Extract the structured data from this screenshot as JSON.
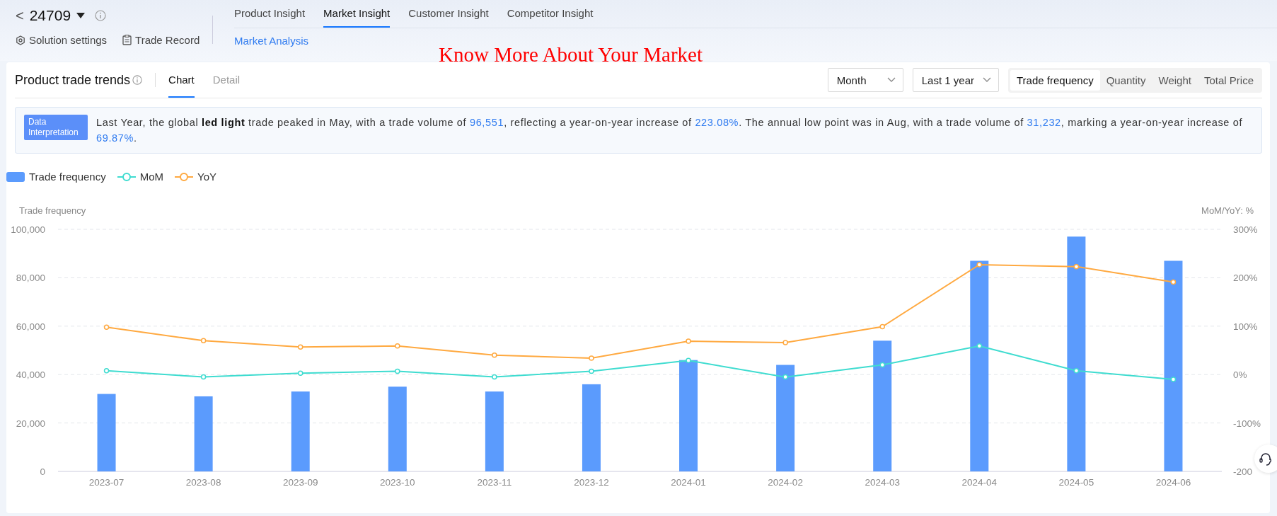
{
  "header": {
    "back": "<",
    "title": "24709",
    "links": [
      {
        "kind": "settings",
        "label": "Solution settings"
      },
      {
        "kind": "record",
        "label": "Trade Record"
      }
    ],
    "tabs": [
      {
        "label": "Product Insight",
        "selected": false
      },
      {
        "label": "Market Insight",
        "selected": true
      },
      {
        "label": "Customer Insight",
        "selected": false
      },
      {
        "label": "Competitor Insight",
        "selected": false
      }
    ],
    "subtabs": [
      {
        "label": "Market Analysis",
        "selected": true
      }
    ]
  },
  "annotation": "Know More About Your Market",
  "panel": {
    "title": "Product trade trends",
    "tabs": [
      {
        "label": "Chart",
        "selected": true
      },
      {
        "label": "Detail",
        "selected": false
      }
    ],
    "selects": [
      {
        "value": "Month"
      },
      {
        "value": "Last 1 year"
      }
    ],
    "metrics": [
      {
        "label": "Trade frequency",
        "selected": true
      },
      {
        "label": "Quantity",
        "selected": false
      },
      {
        "label": "Weight",
        "selected": false
      },
      {
        "label": "Total Price",
        "selected": false
      }
    ],
    "interpretation": {
      "label": "Data Interpretation",
      "segments": [
        {
          "kind": "plain",
          "text": "Last Year, the global "
        },
        {
          "kind": "bold",
          "text": "led light"
        },
        {
          "kind": "plain",
          "text": " trade peaked in May, with a trade volume of "
        },
        {
          "kind": "number",
          "text": "96,551"
        },
        {
          "kind": "plain",
          "text": ", reflecting a year-on-year increase of "
        },
        {
          "kind": "number",
          "text": "223.08%"
        },
        {
          "kind": "plain",
          "text": ". The annual low point was in Aug, with a trade volume of "
        },
        {
          "kind": "number",
          "text": "31,232"
        },
        {
          "kind": "plain",
          "text": ", marking a year-on-year increase of "
        },
        {
          "kind": "number",
          "text": "69.87%"
        },
        {
          "kind": "plain",
          "text": "."
        }
      ]
    },
    "chart_data": {
      "type": "bar",
      "ylabel": "Trade frequency",
      "y2label": "MoM/YoY: %",
      "categories": [
        "2023-07",
        "2023-08",
        "2023-09",
        "2023-10",
        "2023-11",
        "2023-12",
        "2024-01",
        "2024-02",
        "2024-03",
        "2024-04",
        "2024-05",
        "2024-06"
      ],
      "legend": "top-left",
      "grid": true,
      "ylim": [
        0,
        100000
      ],
      "y2lim": [
        -200,
        300
      ],
      "yticks": [
        {
          "value": 0,
          "label": "0"
        },
        {
          "value": 20000,
          "label": "20,000"
        },
        {
          "value": 40000,
          "label": "40,000"
        },
        {
          "value": 60000,
          "label": "60,000"
        },
        {
          "value": 80000,
          "label": "80,000"
        },
        {
          "value": 100000,
          "label": "100,000"
        }
      ],
      "y2ticks": [
        {
          "value": -200,
          "label": "-200"
        },
        {
          "value": -100,
          "label": "-100%"
        },
        {
          "value": 0,
          "label": "0%"
        },
        {
          "value": 100,
          "label": "100%"
        },
        {
          "value": 200,
          "label": "200%"
        },
        {
          "value": 300,
          "label": "300%"
        }
      ],
      "series": [
        {
          "name": "Trade frequency",
          "color": "#5b9bfd",
          "values": [
            32000,
            31000,
            33000,
            35000,
            33000,
            36000,
            46000,
            44000,
            54000,
            87000,
            97000,
            87000
          ]
        },
        {
          "name": "MoM",
          "type": "line",
          "axis": "y2",
          "marker": "circle",
          "color": "#3fdcd0",
          "values": [
            8,
            -5,
            3,
            7,
            -5,
            7,
            29,
            -5,
            20,
            59,
            8,
            -10
          ]
        },
        {
          "name": "YoY",
          "type": "line",
          "axis": "y2",
          "marker": "circle",
          "color": "#ffa940",
          "values": [
            98,
            70,
            57,
            59,
            40,
            34,
            69,
            66,
            99,
            227,
            223,
            191
          ]
        }
      ]
    }
  }
}
